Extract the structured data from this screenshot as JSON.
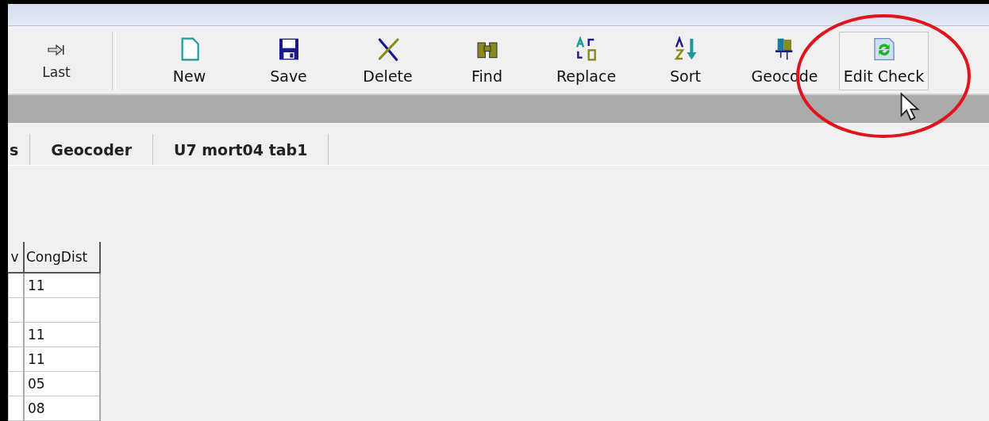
{
  "toolbar": {
    "buttons": [
      {
        "label": "Last",
        "kind": "nav",
        "hovered": false
      },
      {
        "label": "New",
        "kind": "new",
        "hovered": false
      },
      {
        "label": "Save",
        "kind": "save",
        "hovered": false
      },
      {
        "label": "Delete",
        "kind": "delete",
        "hovered": false
      },
      {
        "label": "Find",
        "kind": "find",
        "hovered": false
      },
      {
        "label": "Replace",
        "kind": "replace",
        "hovered": false
      },
      {
        "label": "Sort",
        "kind": "sort",
        "hovered": false
      },
      {
        "label": "Geocode",
        "kind": "geocode",
        "hovered": false
      },
      {
        "label": "Edit Check",
        "kind": "editcheck",
        "hovered": true
      }
    ]
  },
  "tabs": [
    {
      "label": "s",
      "selected": false
    },
    {
      "label": "Geocoder",
      "selected": false
    },
    {
      "label": "U7 mort04 tab1",
      "selected": false
    }
  ],
  "table": {
    "columns": [
      "v",
      "CongDist"
    ],
    "rows": [
      [
        "",
        "11"
      ],
      [
        "",
        ""
      ],
      [
        "",
        "11"
      ],
      [
        "",
        "11"
      ],
      [
        "",
        "05"
      ],
      [
        "",
        "08"
      ]
    ]
  }
}
